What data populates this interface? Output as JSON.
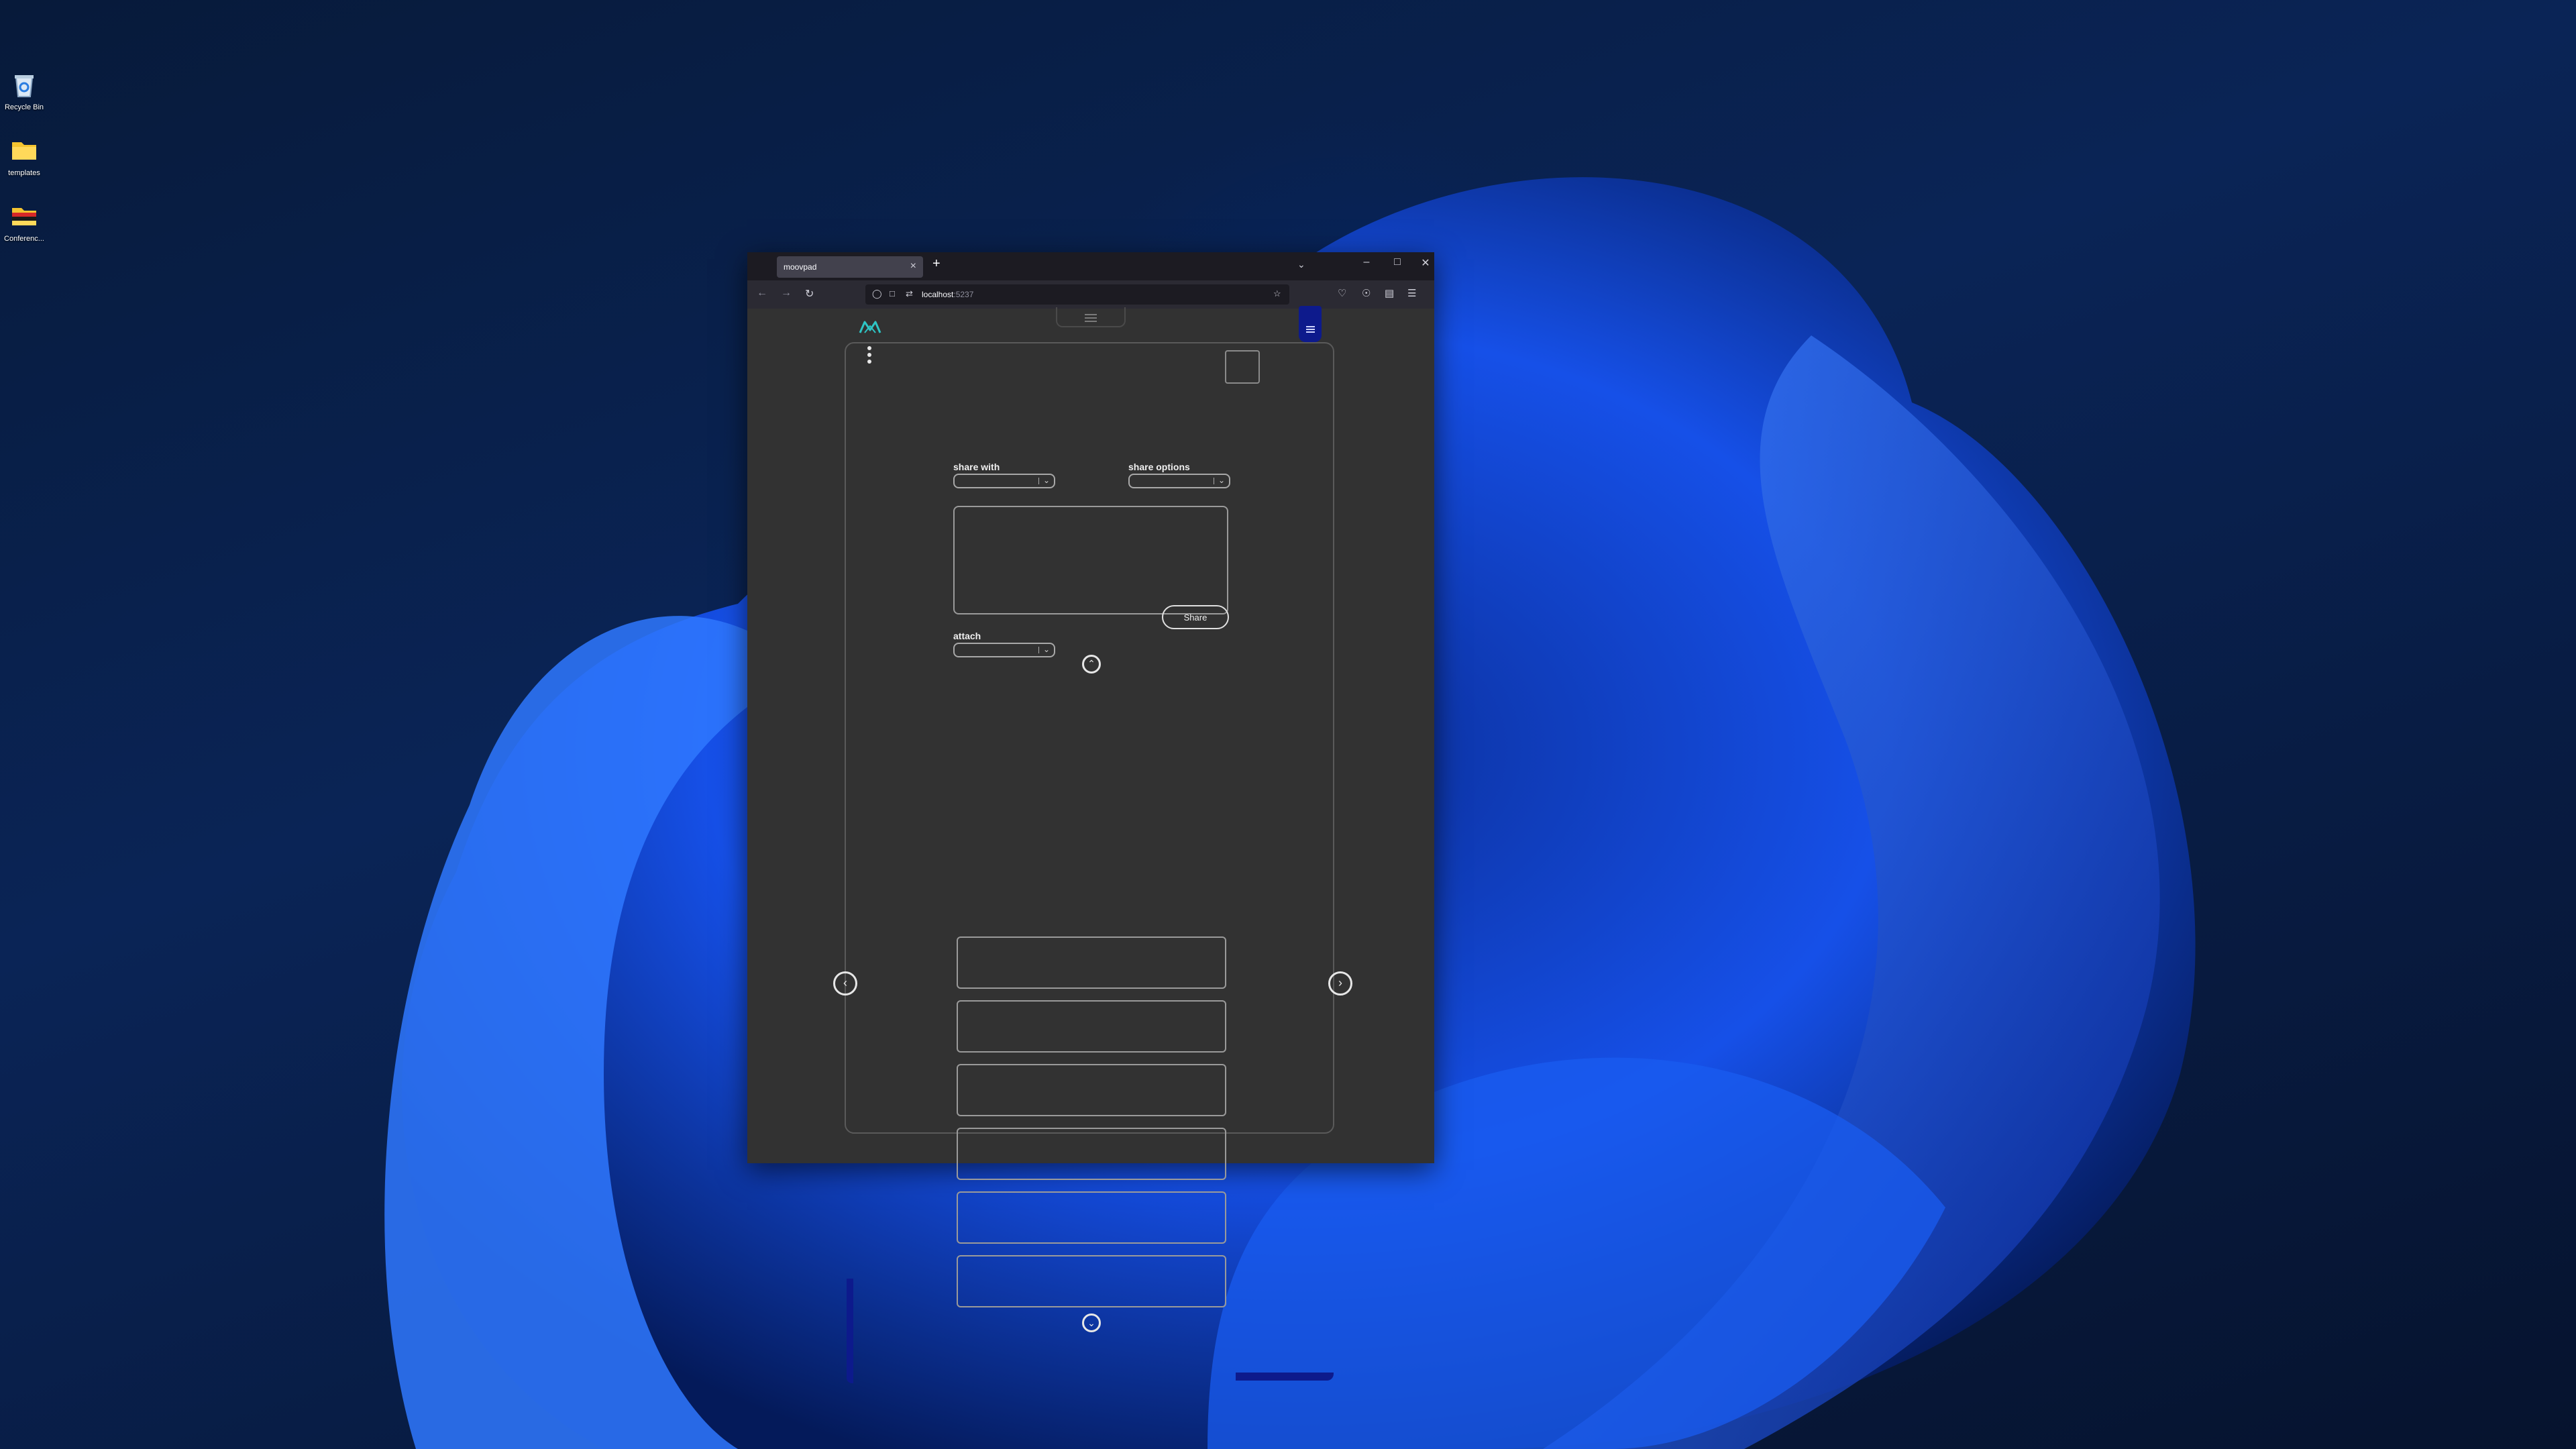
{
  "desktop": {
    "icons": [
      {
        "label": "Recycle Bin",
        "icon": "recycle-bin-icon"
      },
      {
        "label": "templates",
        "icon": "folder-icon"
      },
      {
        "label": "Conferenc...",
        "icon": "folder-striped-icon"
      }
    ]
  },
  "browser": {
    "tab_title": "moovpad",
    "url_host": "localhost",
    "url_port": ":5237",
    "new_tab_label": "+",
    "close_tab_label": "×"
  },
  "app": {
    "share_with_label": "share with",
    "share_options_label": "share options",
    "attach_label": "attach",
    "share_button_label": "Share",
    "list_cards": [
      "",
      "",
      "",
      "",
      "",
      ""
    ],
    "accent_color": "#0d1a8c",
    "logo_color": "#2ec4c4"
  }
}
